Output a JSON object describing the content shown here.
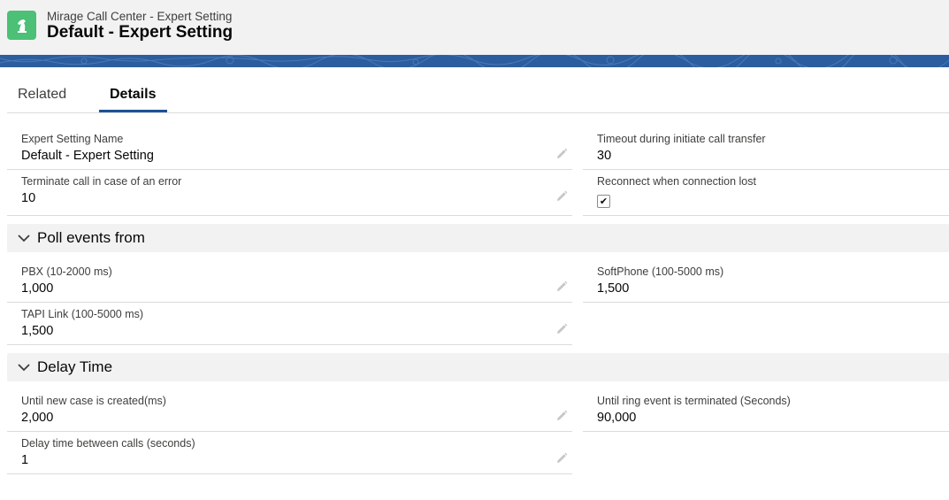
{
  "header": {
    "app_icon": "chess-knight-icon",
    "subtitle": "Mirage Call Center - Expert Setting",
    "title": "Default - Expert Setting"
  },
  "tabs": [
    {
      "label": "Related",
      "active": false
    },
    {
      "label": "Details",
      "active": true
    }
  ],
  "general": {
    "expert_setting_name": {
      "label": "Expert Setting Name",
      "value": "Default - Expert Setting"
    },
    "terminate_call": {
      "label": "Terminate call in case of an error",
      "value": "10"
    },
    "timeout_transfer": {
      "label": "Timeout during initiate call transfer",
      "value": "30"
    },
    "reconnect": {
      "label": "Reconnect when connection lost",
      "checked": true
    }
  },
  "poll_section": {
    "title": "Poll events from",
    "pbx": {
      "label": "PBX (10-2000 ms)",
      "value": "1,000"
    },
    "tapi_link": {
      "label": "TAPI Link (100-5000 ms)",
      "value": "1,500"
    },
    "softphone": {
      "label": "SoftPhone (100-5000 ms)",
      "value": "1,500"
    }
  },
  "delay_section": {
    "title": "Delay Time",
    "new_case": {
      "label": "Until new case is created(ms)",
      "value": "2,000"
    },
    "between_calls": {
      "label": "Delay time between calls (seconds)",
      "value": "1"
    },
    "ring_event": {
      "label": "Until ring event is terminated (Seconds)",
      "value": "90,000"
    }
  },
  "colors": {
    "brand_green": "#4bc076",
    "banner_blue": "#2c5d9e",
    "active_tab": "#1b5297"
  }
}
